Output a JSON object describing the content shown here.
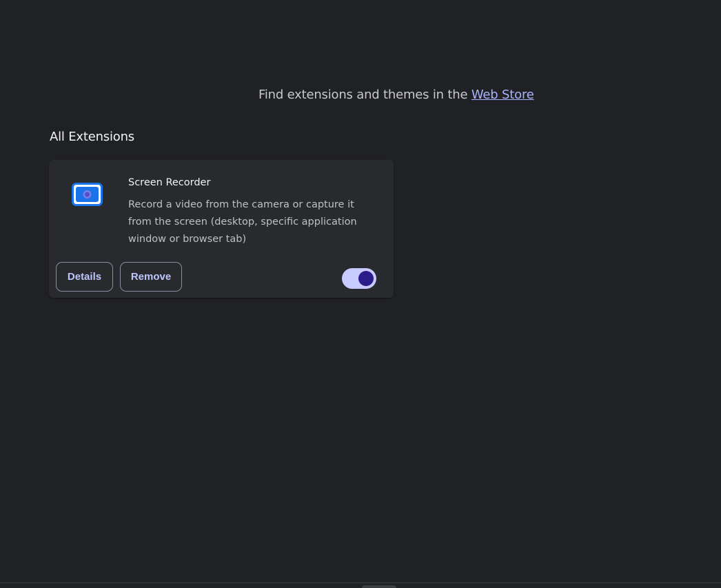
{
  "header": {
    "webstore_prefix": "Find extensions and themes in the ",
    "webstore_link": "Web Store"
  },
  "section": {
    "title": "All Extensions"
  },
  "extension": {
    "icon": "screen-recorder-icon",
    "name": "Screen Recorder",
    "description": "Record a video from the camera or capture it from the screen (desktop, specific application window or browser tab)",
    "details_label": "Details",
    "remove_label": "Remove",
    "enabled": true
  },
  "colors": {
    "background": "#202124",
    "card": "#292a2d",
    "accent": "#aab2ff",
    "toggle_track": "#c8cbff",
    "toggle_knob": "#2b1c8a",
    "icon_blue": "#1a73e8"
  }
}
